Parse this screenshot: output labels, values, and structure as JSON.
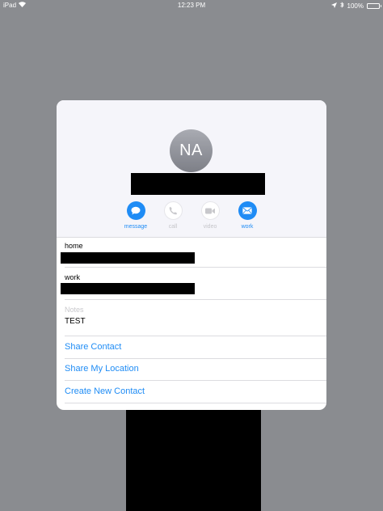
{
  "status_bar": {
    "device": "iPad",
    "time": "12:23 PM",
    "battery": "100%"
  },
  "contact": {
    "initials": "NA",
    "actions": [
      {
        "label": "message",
        "icon": "message-icon",
        "enabled": true
      },
      {
        "label": "call",
        "icon": "phone-icon",
        "enabled": false
      },
      {
        "label": "video",
        "icon": "video-icon",
        "enabled": false
      },
      {
        "label": "work",
        "icon": "mail-icon",
        "enabled": true
      }
    ],
    "fields": [
      {
        "label": "home"
      },
      {
        "label": "work"
      }
    ],
    "notes": {
      "label": "Notes",
      "value": "TEST"
    },
    "links": [
      {
        "label": "Share Contact"
      },
      {
        "label": "Share My Location"
      },
      {
        "label": "Create New Contact"
      }
    ]
  },
  "colors": {
    "accent": "#1f8cf5",
    "backdrop": "#8a8c90"
  }
}
